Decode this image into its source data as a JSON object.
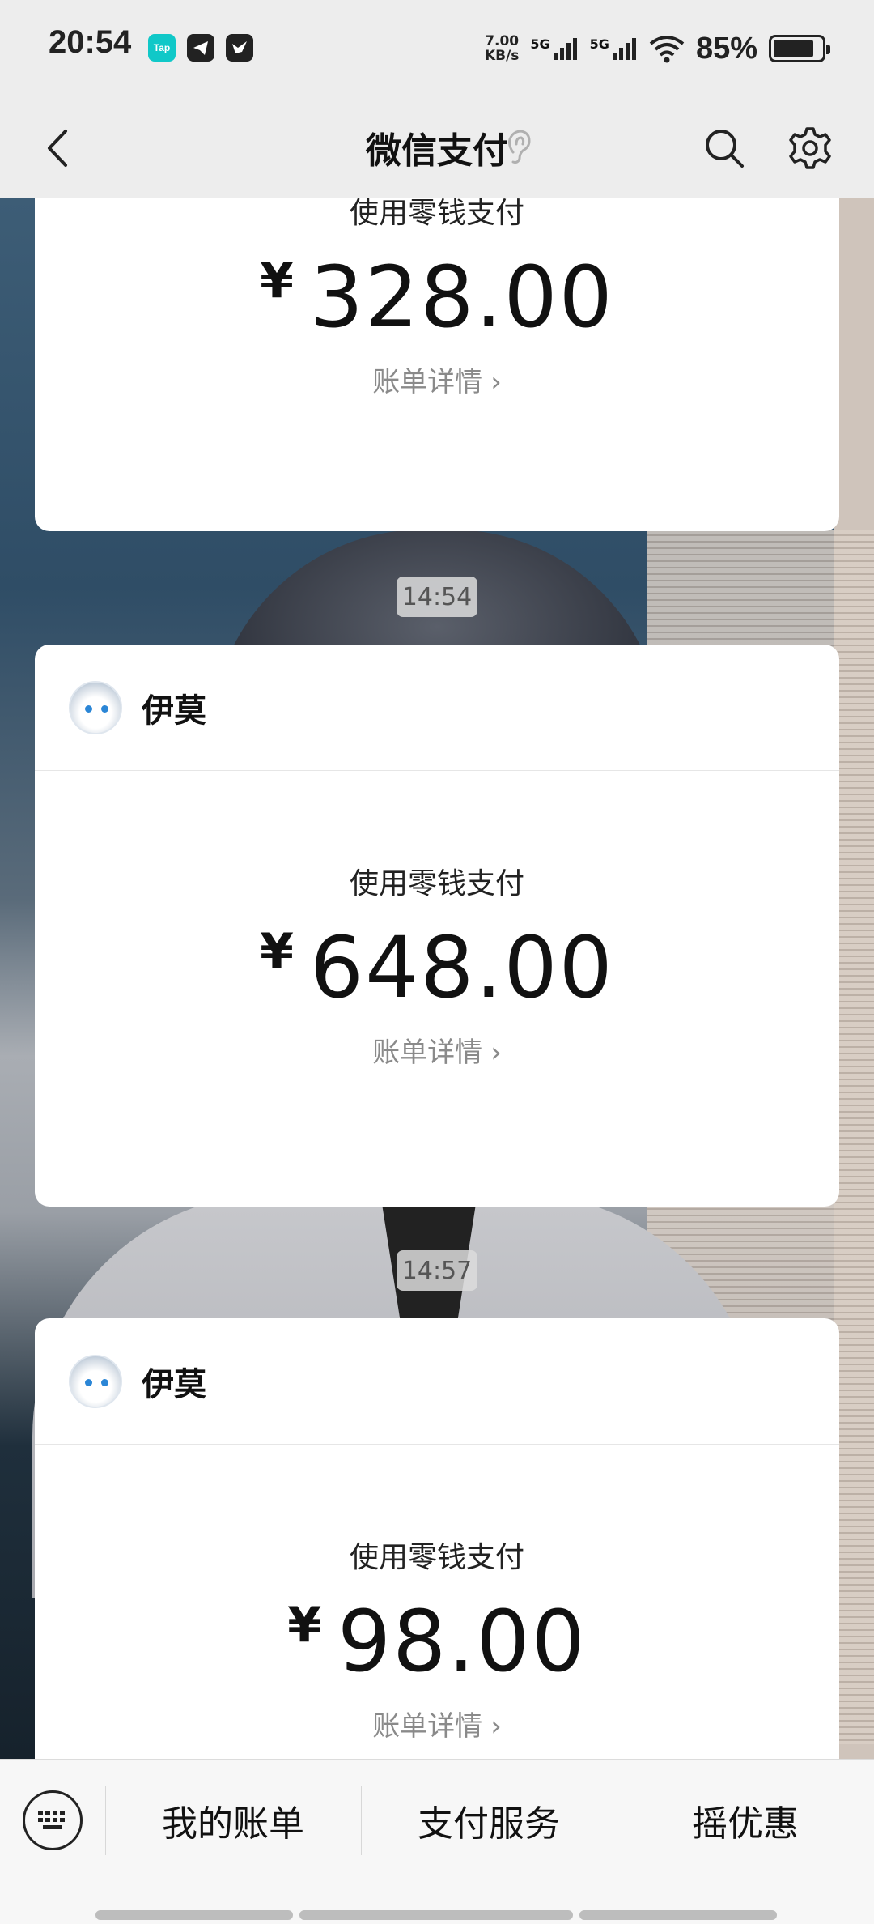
{
  "status_bar": {
    "time": "20:54",
    "net_speed_value": "7.00",
    "net_speed_unit": "KB/s",
    "signal1": "5G",
    "signal2": "5G",
    "battery": "85%",
    "battery_level": 0.85
  },
  "header": {
    "title": "微信支付",
    "back_icon": "back-chevron-icon",
    "search_icon": "search-icon",
    "settings_icon": "gear-icon"
  },
  "messages": [
    {
      "pay_method": "使用零钱支付",
      "currency": "¥",
      "amount": "328.00",
      "detail": "账单详情"
    },
    {
      "timestamp": "14:54",
      "sender": "伊莫",
      "pay_method": "使用零钱支付",
      "currency": "¥",
      "amount": "648.00",
      "detail": "账单详情"
    },
    {
      "timestamp": "14:57",
      "sender": "伊莫",
      "pay_method": "使用零钱支付",
      "currency": "¥",
      "amount": "98.00",
      "detail": "账单详情"
    }
  ],
  "bottom_menu": {
    "keyboard_icon": "keyboard-icon",
    "items": [
      "我的账单",
      "支付服务",
      "摇优惠"
    ]
  },
  "colors": {
    "accent_status_icon": "#10c8c8",
    "text_primary": "#111111",
    "text_secondary": "#8a8a8a"
  }
}
